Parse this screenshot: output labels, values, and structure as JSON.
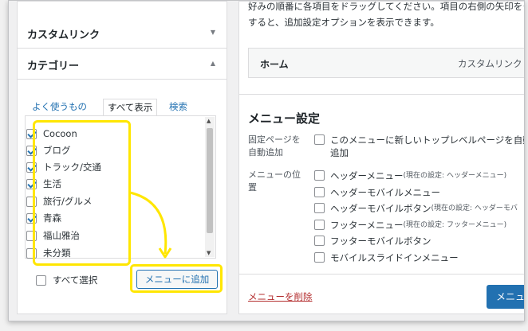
{
  "left_panel": {
    "custom_link": {
      "title": "カスタムリンク",
      "arrow": "▼"
    },
    "category": {
      "title": "カテゴリー",
      "arrow": "▲"
    },
    "tabs": [
      {
        "label": "よく使うもの",
        "active": false
      },
      {
        "label": "すべて表示",
        "active": true
      },
      {
        "label": "検索",
        "active": false
      }
    ],
    "items": [
      {
        "label": "Cocoon",
        "checked": true
      },
      {
        "label": "ブログ",
        "checked": true
      },
      {
        "label": "トラック/交通",
        "checked": true
      },
      {
        "label": "生活",
        "checked": true
      },
      {
        "label": "旅行/グルメ",
        "checked": false
      },
      {
        "label": "青森",
        "checked": true
      },
      {
        "label": "福山雅治",
        "checked": false
      },
      {
        "label": "未分類",
        "checked": false
      }
    ],
    "select_all": "すべて選択",
    "add_button": "メニューに追加"
  },
  "right_panel": {
    "intro_line1": "好みの順番に各項目をドラッグしてください。項目の右側の矢印をク",
    "intro_line2": "すると、追加設定オプションを表示できます。",
    "menu_item": {
      "title": "ホーム",
      "type": "カスタムリンク"
    },
    "settings_title": "メニュー設定",
    "auto_add_label": "固定ページを自動追加",
    "auto_add_option": "このメニューに新しいトップレベルページを自動追加",
    "location_label": "メニューの位置",
    "locations": [
      {
        "label": "ヘッダーメニュー",
        "note": "(現在の設定: ヘッダーメニュー)"
      },
      {
        "label": "ヘッダーモバイルメニュー",
        "note": ""
      },
      {
        "label": "ヘッダーモバイルボタン",
        "note": "(現在の設定: ヘッダーモバ"
      },
      {
        "label": "フッターメニュー",
        "note": "(現在の設定: フッターメニュー)"
      },
      {
        "label": "フッターモバイルボタン",
        "note": ""
      },
      {
        "label": "モバイルスライドインメニュー",
        "note": ""
      }
    ],
    "delete_link": "メニューを削除",
    "save_button": "メニュー"
  },
  "colors": {
    "highlight": "#ffe600",
    "link": "#2271b1",
    "delete": "#b32d2e",
    "primary": "#2271b1"
  }
}
